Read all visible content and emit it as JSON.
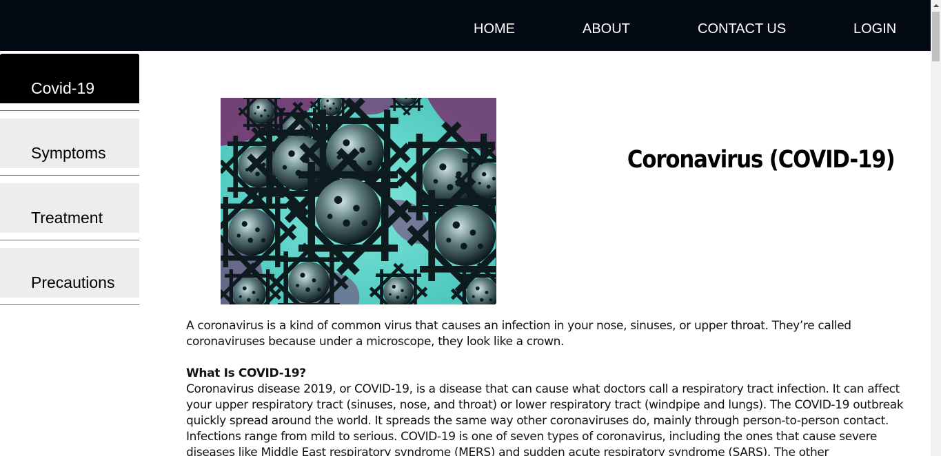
{
  "nav": {
    "links": [
      {
        "label": "HOME"
      },
      {
        "label": "ABOUT"
      },
      {
        "label": "CONTACT US"
      },
      {
        "label": "LOGIN"
      }
    ]
  },
  "sidebar": {
    "items": [
      {
        "label": "Covid-19",
        "active": true
      },
      {
        "label": "Symptoms",
        "active": false
      },
      {
        "label": "Treatment",
        "active": false
      },
      {
        "label": "Precautions",
        "active": false
      }
    ]
  },
  "page": {
    "title": "Coronavirus (COVID-19)"
  },
  "article": {
    "intro": "A coronavirus is a kind of common virus that causes an infection in your nose, sinuses, or upper throat. They’re called coronaviruses because under a microscope, they look like a crown.",
    "section_heading": "What Is COVID-19?",
    "section_body": "Coronavirus disease 2019, or COVID-19, is a disease that can cause what doctors call a respiratory tract infection. It can affect your upper respiratory tract (sinuses, nose, and throat) or lower respiratory tract (windpipe and lungs). The COVID-19 outbreak quickly spread around the world. It spreads the same way other coronaviruses do, mainly through person-to-person contact. Infections range from mild to serious. COVID-19 is one of seven types of coronavirus, including the ones that cause severe diseases like Middle East respiratory syndrome (MERS) and sudden acute respiratory syndrome (SARS). The other"
  },
  "colors": {
    "topbar": "#040a14",
    "sidebar_active": "#000000",
    "sidebar_inactive": "#ededed",
    "hero_background_teal": "#5fd8cc",
    "hero_background_purple": "#7a2a68"
  }
}
